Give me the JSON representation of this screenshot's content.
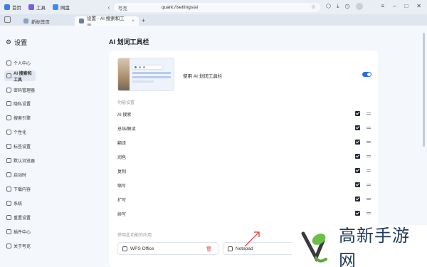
{
  "bookmarks": [
    {
      "label": "首页",
      "color": "#3d7be8"
    },
    {
      "label": "工具",
      "color": "#7a5ce0"
    },
    {
      "label": "网盘",
      "color": "#3a8ef0"
    }
  ],
  "address": {
    "label": "夸克",
    "url": "quark://settings/ai"
  },
  "tabs": [
    {
      "label": "新标签页"
    },
    {
      "label": "设置 - AI 搜索和工具"
    }
  ],
  "sidebar": {
    "title": "设置",
    "items": [
      {
        "label": "个人中心"
      },
      {
        "label": "AI 搜索和工具"
      },
      {
        "label": "密码管理器"
      },
      {
        "label": "隐私设置"
      },
      {
        "label": "搜索引擎"
      },
      {
        "label": "个性化"
      },
      {
        "label": "标签设置"
      },
      {
        "label": "默认浏览器"
      },
      {
        "label": "启动时"
      },
      {
        "label": "下载内容"
      },
      {
        "label": "系统"
      },
      {
        "label": "重置设置"
      },
      {
        "label": "插件中心"
      },
      {
        "label": "关于夸克"
      }
    ]
  },
  "main": {
    "title": "AI 划词工具栏",
    "use_label": "使用 AI 划词工具栏",
    "toggle_on": true,
    "section_label": "功能设置",
    "features": [
      {
        "label": "AI 搜索",
        "checked": true
      },
      {
        "label": "总结/解读",
        "checked": true
      },
      {
        "label": "翻译",
        "checked": true
      },
      {
        "label": "润色",
        "checked": true
      },
      {
        "label": "复制",
        "checked": true
      },
      {
        "label": "缩写",
        "checked": true
      },
      {
        "label": "扩写",
        "checked": true
      },
      {
        "label": "续写",
        "checked": true
      }
    ],
    "apps_label": "停用此功能的应用",
    "apps": [
      {
        "label": "WPS Office"
      },
      {
        "label": "Notepad"
      }
    ]
  },
  "watermark": {
    "text": "高新手游网"
  },
  "colors": {
    "accent": "#2b6fe0",
    "checkbox": "#1f2a3a",
    "annotation": "#e03030"
  }
}
